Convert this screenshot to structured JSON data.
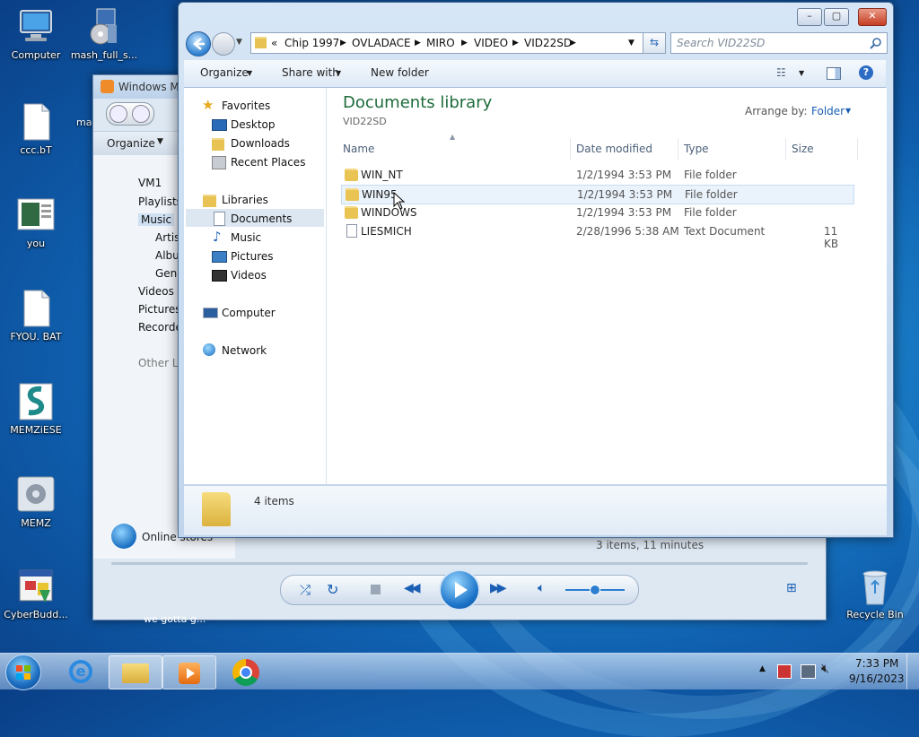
{
  "desktop_icons": [
    {
      "label": "Computer",
      "icon": "computer-icon"
    },
    {
      "label": "mash_full_s...",
      "icon": "installer-icon"
    },
    {
      "label": "ccc.bT",
      "icon": "text-file-icon"
    },
    {
      "label": "you",
      "icon": "image-file-icon"
    },
    {
      "label": "FYOU. BAT",
      "icon": "batch-file-icon"
    },
    {
      "label": "MEMZiESE",
      "icon": "memz-icon"
    },
    {
      "label": "MEMZ",
      "icon": "settings-icon"
    },
    {
      "label": "CyberBudd...",
      "icon": "app-icon"
    },
    {
      "label": "Recycle Bin",
      "icon": "recycle-bin-icon"
    }
  ],
  "wmp": {
    "title": "Windows M",
    "organize": "Organize",
    "nav": [
      "VM1",
      "Playlists",
      "Music",
      "Artis",
      "Albu",
      "Genr",
      "Videos",
      "Pictures",
      "Recorde",
      "Other Li"
    ],
    "online_stores": "Online stores",
    "status": "3 items, 11 minutes",
    "behind_text": "we gotta g..."
  },
  "explorer": {
    "breadcrumb": [
      "«",
      "Chip 1997",
      "OVLADACE",
      "MIRO",
      "VIDEO",
      "VID22SD"
    ],
    "search_placeholder": "Search VID22SD",
    "toolbar": {
      "organize": "Organize",
      "share_with": "Share with",
      "new_folder": "New folder"
    },
    "nav": {
      "favorites": "Favorites",
      "favorites_items": [
        "Desktop",
        "Downloads",
        "Recent Places"
      ],
      "libraries": "Libraries",
      "libraries_items": [
        "Documents",
        "Music",
        "Pictures",
        "Videos"
      ],
      "computer": "Computer",
      "network": "Network"
    },
    "library_title": "Documents library",
    "library_sub": "VID22SD",
    "arrange_label": "Arrange by:",
    "arrange_value": "Folder",
    "columns": [
      "Name",
      "Date modified",
      "Type",
      "Size"
    ],
    "files": [
      {
        "name": "WIN_NT",
        "date": "1/2/1994 3:53 PM",
        "type": "File folder",
        "size": ""
      },
      {
        "name": "WIN95",
        "date": "1/2/1994 3:53 PM",
        "type": "File folder",
        "size": ""
      },
      {
        "name": "WINDOWS",
        "date": "1/2/1994 3:53 PM",
        "type": "File folder",
        "size": ""
      },
      {
        "name": "LIESMICH",
        "date": "2/28/1996 5:38 AM",
        "type": "Text Document",
        "size": "11 KB"
      }
    ],
    "item_count": "4 items"
  },
  "taskbar": {
    "time": "7:33 PM",
    "date": "9/16/2023"
  },
  "colors": {
    "library_title": "#1e6b3b",
    "link_blue": "#1a5fb4",
    "selected_row": "#dfeaf7"
  }
}
